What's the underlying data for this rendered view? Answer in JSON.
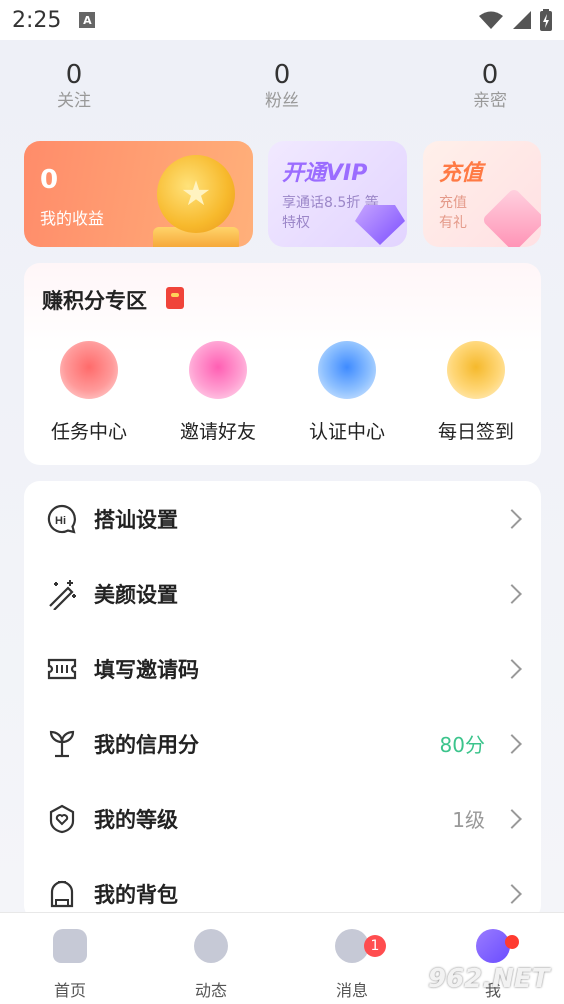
{
  "status_bar": {
    "time": "2:25",
    "notification_icon_letter": "A"
  },
  "stats": [
    {
      "value": "0",
      "label": "关注"
    },
    {
      "value": "0",
      "label": "粉丝"
    },
    {
      "value": "0",
      "label": "亲密"
    }
  ],
  "earnings": {
    "value": "0",
    "label": "我的收益"
  },
  "vip": {
    "title": "开通VIP",
    "subtitle": "享通话8.5折 等特权"
  },
  "recharge": {
    "title": "充值",
    "subtitle": "充值 有礼"
  },
  "points_section": {
    "title": "赚积分专区",
    "items": [
      {
        "label": "任务中心",
        "icon": "gift-icon"
      },
      {
        "label": "邀请好友",
        "icon": "user-icon"
      },
      {
        "label": "认证中心",
        "icon": "shield-check-icon"
      },
      {
        "label": "每日签到",
        "icon": "calendar-check-icon"
      }
    ]
  },
  "menu": [
    {
      "label": "搭讪设置",
      "icon": "hi-chat-icon",
      "value": ""
    },
    {
      "label": "美颜设置",
      "icon": "magic-wand-icon",
      "value": ""
    },
    {
      "label": "填写邀请码",
      "icon": "ticket-icon",
      "value": ""
    },
    {
      "label": "我的信用分",
      "icon": "sprout-icon",
      "value": "80分",
      "value_color": "#3cc48c"
    },
    {
      "label": "我的等级",
      "icon": "badge-heart-icon",
      "value": "1级",
      "value_color": "#999999"
    },
    {
      "label": "我的背包",
      "icon": "backpack-icon",
      "value": ""
    }
  ],
  "tabs": [
    {
      "label": "首页",
      "icon": "home-icon"
    },
    {
      "label": "动态",
      "icon": "compass-icon"
    },
    {
      "label": "消息",
      "icon": "chat-icon",
      "badge": "1"
    },
    {
      "label": "我",
      "icon": "profile-face-icon"
    }
  ],
  "watermark": "962.NET"
}
